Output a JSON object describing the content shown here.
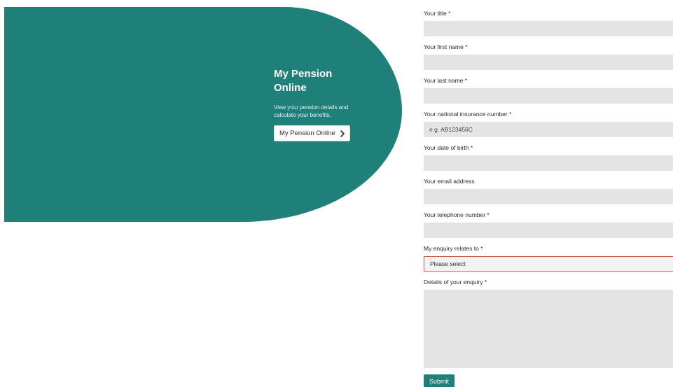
{
  "promo": {
    "title": "My Pension Online",
    "description": "View your pension details and calculate your benefits.",
    "button_label": "My Pension Online"
  },
  "form": {
    "fields": [
      {
        "label": "Your title *",
        "value": "",
        "placeholder": ""
      },
      {
        "label": "Your first name *",
        "value": "",
        "placeholder": ""
      },
      {
        "label": "Your last name *",
        "value": "",
        "placeholder": ""
      },
      {
        "label": "Your national insurance number *",
        "value": "",
        "placeholder": "e.g. AB123456C"
      },
      {
        "label": "Your date of birth *",
        "value": "",
        "placeholder": ""
      },
      {
        "label": "Your email address",
        "value": "",
        "placeholder": ""
      },
      {
        "label": "Your telephone number *",
        "value": "",
        "placeholder": ""
      }
    ],
    "enquiry": {
      "label": "My enquiry relates to *",
      "selected": "Please select"
    },
    "details": {
      "label": "Details of your enquiry *",
      "value": ""
    },
    "submit_label": "Submit"
  },
  "colors": {
    "brand_teal": "#1f7f79",
    "input_bg": "#e4e4e4",
    "error_border": "#d9534f"
  }
}
